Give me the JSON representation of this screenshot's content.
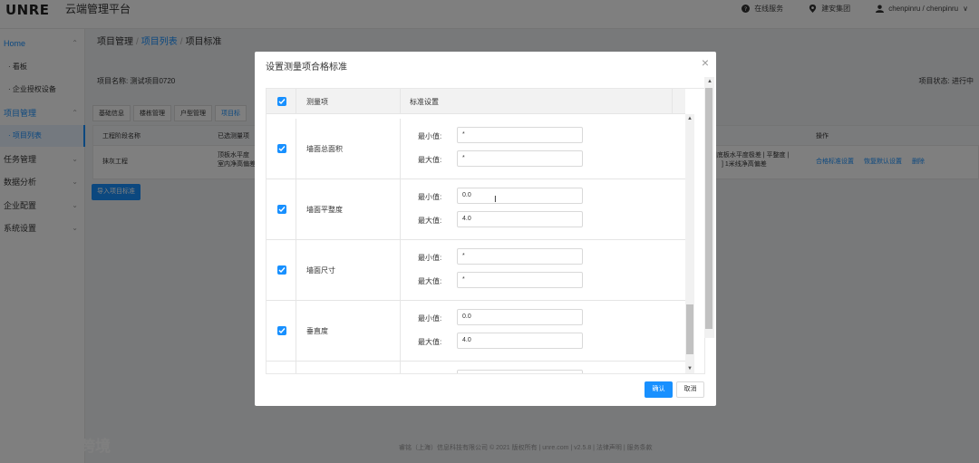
{
  "header": {
    "logo": "UNRE",
    "app_title": "云端管理平台",
    "service": "在线服务",
    "company": "建安集团",
    "user": "chenpinru / chenpinru"
  },
  "sidebar": {
    "items": [
      {
        "label": "Home"
      },
      {
        "label": "· 看板"
      },
      {
        "label": "· 企业授权设备"
      },
      {
        "label": "项目管理"
      },
      {
        "label": "· 项目列表"
      },
      {
        "label": "任务管理"
      },
      {
        "label": "数据分析"
      },
      {
        "label": "企业配置"
      },
      {
        "label": "系统设置"
      }
    ]
  },
  "breadcrumb": {
    "part1": "项目管理",
    "part2": "项目列表",
    "part3": "项目标准",
    "sep": "/"
  },
  "project": {
    "name": "项目名称: 测试项目0720",
    "status": "项目状态: 进行中"
  },
  "tabs": [
    "基础信息",
    "楼栋管理",
    "户型管理",
    "项目标"
  ],
  "table": {
    "headers": {
      "stage": "工程阶段名称",
      "selected": "已选测量项",
      "ops": "操作"
    },
    "row": {
      "stage": "抹灰工程",
      "selected_line1": "顶板水平度",
      "selected_line2": "室内净高偏差",
      "right_line1": "|底板水平度极差 | 平整度 |",
      "right_line2": "] 1米线净高偏差",
      "op1": "合格标准设置",
      "op2": "恢复默认设置",
      "op3": "删除"
    }
  },
  "import_button": "导入项目标准",
  "footer": "睿铭（上海）信息科技有限公司 © 2021 版权所有 | unre.com | v2.5.8 | 法律声明 | 服务条款",
  "watermark": "大数跨境",
  "modal": {
    "title": "设置测量项合格标准",
    "col_item": "测量项",
    "col_standard": "标准设置",
    "min_label": "最小值:",
    "max_label": "最大值:",
    "rows": [
      {
        "name": "墙面总面积",
        "min": "*",
        "max": "*"
      },
      {
        "name": "墙面平整度",
        "min": "0.0",
        "max": "4.0"
      },
      {
        "name": "墙面尺寸",
        "min": "*",
        "max": "*"
      },
      {
        "name": "垂直度",
        "min": "0.0",
        "max": "4.0"
      }
    ],
    "confirm": "确认",
    "cancel": "取消"
  },
  "colors": {
    "accent": "#1890ff"
  }
}
